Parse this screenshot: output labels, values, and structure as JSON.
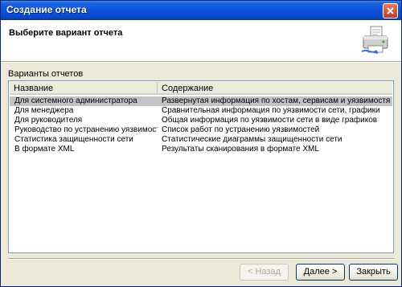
{
  "window": {
    "title": "Создание отчета"
  },
  "header": {
    "title": "Выберите вариант отчета"
  },
  "group": {
    "label": "Варианты отчетов"
  },
  "list": {
    "columns": [
      "Название",
      "Содержание"
    ],
    "rows": [
      {
        "name": "Для системного администратора",
        "content": "Развернутая информация по хостам, сервисам и уязвимостям",
        "selected": true
      },
      {
        "name": "Для менеджера",
        "content": "Сравнительная информация по уязвимости сети, графики",
        "selected": false
      },
      {
        "name": "Для руководителя",
        "content": "Общая информация по уязвимости сети в виде графиков",
        "selected": false
      },
      {
        "name": "Руководство по устранению уязвимостей",
        "content": "Список работ по устранению уязвимостей",
        "selected": false
      },
      {
        "name": "Статистика защищенности сети",
        "content": "Статистические диаграммы защищенности сети",
        "selected": false
      },
      {
        "name": "В формате XML",
        "content": "Результаты сканирования в формате XML",
        "selected": false
      }
    ]
  },
  "buttons": {
    "back": "< Назад",
    "next": "Далее >",
    "close": "Закрыть"
  },
  "icons": {
    "close": "close-icon",
    "printer": "printer-icon"
  },
  "colors": {
    "titlebar": "#0a47c8",
    "selection": "#c3c3c3",
    "dialog_bg": "#ece9d8"
  }
}
